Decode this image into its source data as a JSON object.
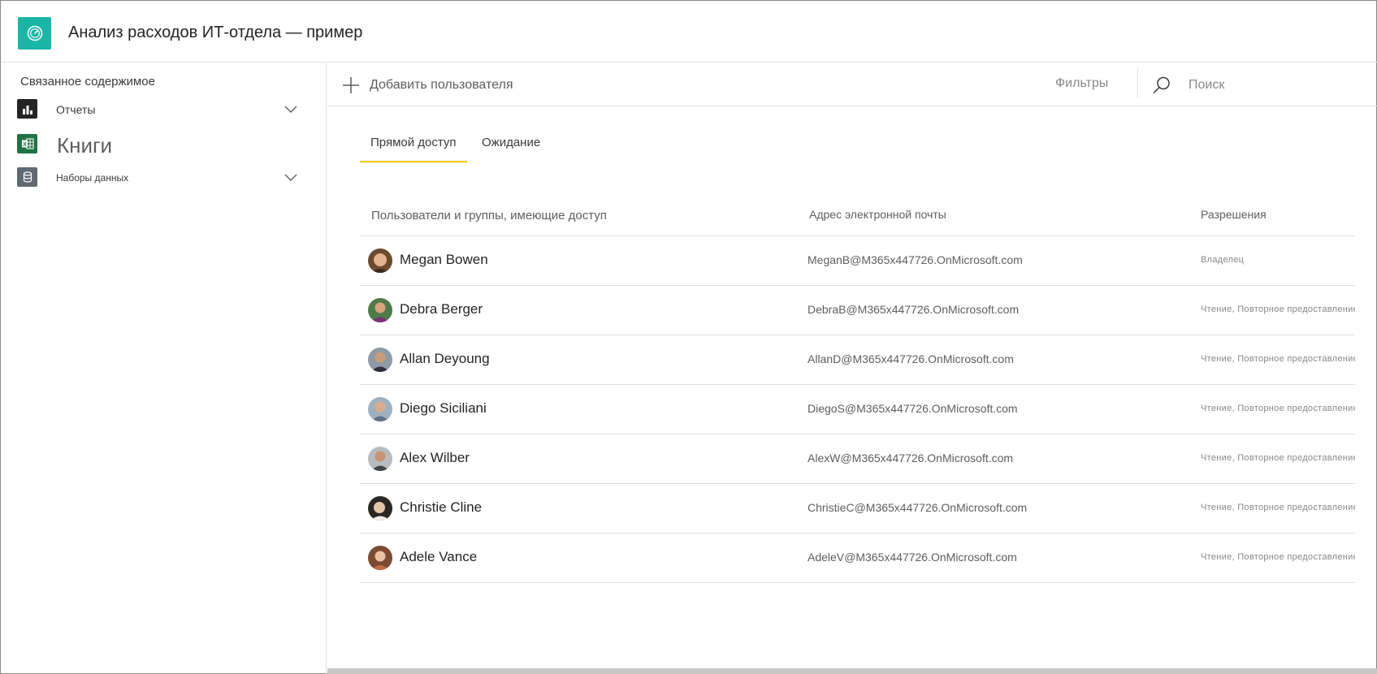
{
  "header": {
    "app_icon": "gauge-icon",
    "title": "Анализ расходов ИТ-отдела — пример",
    "accent_color": "#19b6a6"
  },
  "sidebar": {
    "heading": "Связанное содержимое",
    "items": [
      {
        "label": "Отчеты",
        "icon": "report-icon",
        "expandable": true
      },
      {
        "label": "Книги",
        "icon": "excel-workbook-icon",
        "expandable": false
      },
      {
        "label": "Наборы данных",
        "icon": "dataset-icon",
        "expandable": true
      }
    ]
  },
  "toolbar": {
    "add_user_label": "Добавить пользователя",
    "filters_label": "Фильтры",
    "search_placeholder": "Поиск"
  },
  "tabs": [
    {
      "label": "Прямой доступ",
      "active": true
    },
    {
      "label": "Ожидание",
      "active": false
    }
  ],
  "table": {
    "columns": [
      "Пользователи и группы, имеющие доступ",
      "Адрес электронной почты",
      "Разрешения"
    ],
    "rows": [
      {
        "name": "Megan Bowen",
        "email": "MeganB@M365x447726.OnMicrosoft.com",
        "permissions": "Владелец"
      },
      {
        "name": "Debra Berger",
        "email": "DebraB@M365x447726.OnMicrosoft.com",
        "permissions": "Чтение,  Повторное  предоставление"
      },
      {
        "name": "Allan Deyoung",
        "email": "AllanD@M365x447726.OnMicrosoft.com",
        "permissions": "Чтение, Повторное предоставление об"
      },
      {
        "name": "Diego Siciliani",
        "email": "DiegoS@M365x447726.OnMicrosoft.com",
        "permissions": "Чтение,  Повторное  предоставление"
      },
      {
        "name": "Alex Wilber",
        "email": "AlexW@M365x447726.OnMicrosoft.com",
        "permissions": "Чтение,  Повторное  предоставление"
      },
      {
        "name": "Christie Cline",
        "email": "ChristieC@M365x447726.OnMicrosoft.com",
        "permissions": "Чтение,  Повторное  предоставление"
      },
      {
        "name": "Adele Vance",
        "email": "AdeleV@M365x447726.OnMicrosoft.com",
        "permissions": "Чтение,  Повторное  предоставление"
      }
    ]
  }
}
